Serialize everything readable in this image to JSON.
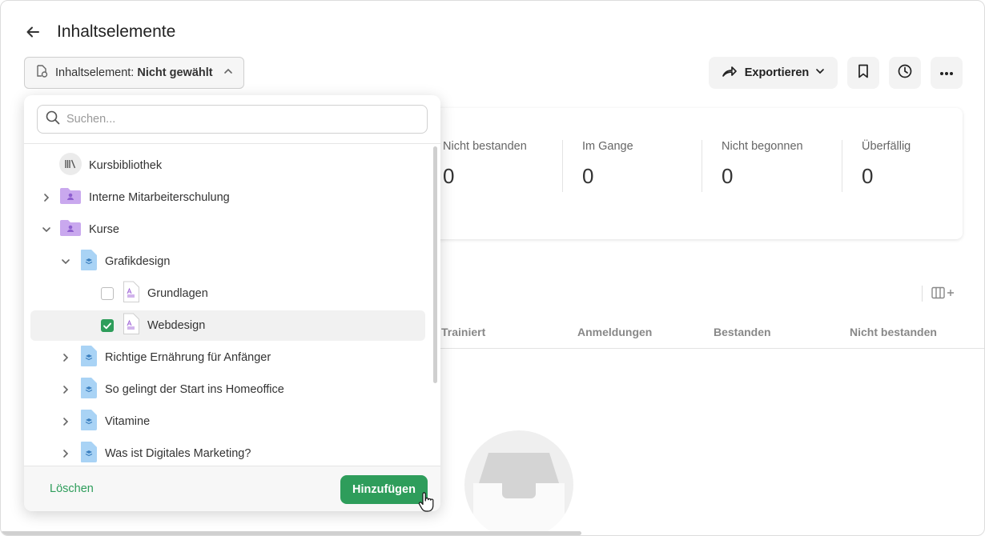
{
  "header": {
    "title": "Inhaltselemente"
  },
  "selector": {
    "label": "Inhaltselement:",
    "value": "Nicht gewählt"
  },
  "toolbar": {
    "export_label": "Exportieren"
  },
  "stats": [
    {
      "label": "Nicht bestanden",
      "value": "0"
    },
    {
      "label": "Im Gange",
      "value": "0"
    },
    {
      "label": "Nicht begonnen",
      "value": "0"
    },
    {
      "label": "Überfällig",
      "value": "0"
    }
  ],
  "table": {
    "columns": [
      "Trainiert",
      "Anmeldungen",
      "Bestanden",
      "Nicht bestanden"
    ]
  },
  "dropdown": {
    "search_placeholder": "Suchen...",
    "items": [
      {
        "label": "Kursbibliothek",
        "icon": "library-icon"
      },
      {
        "label": "Interne Mitarbeiterschulung",
        "icon": "folder-icon",
        "expanded": false
      },
      {
        "label": "Kurse",
        "icon": "folder-icon",
        "expanded": true
      },
      {
        "label": "Grafikdesign",
        "icon": "course-icon",
        "expanded": true
      },
      {
        "label": "Grundlagen",
        "icon": "document-icon",
        "checked": false
      },
      {
        "label": "Webdesign",
        "icon": "document-icon",
        "checked": true
      },
      {
        "label": "Richtige Ernährung für Anfänger",
        "icon": "course-icon",
        "expanded": false
      },
      {
        "label": "So gelingt der Start ins Homeoffice",
        "icon": "course-icon",
        "expanded": false
      },
      {
        "label": "Vitamine",
        "icon": "course-icon",
        "expanded": false
      },
      {
        "label": "Was ist Digitales Marketing?",
        "icon": "course-icon",
        "expanded": false
      }
    ],
    "clear_label": "Löschen",
    "add_label": "Hinzufügen"
  },
  "colors": {
    "accent": "#2e9d5b",
    "folder": "#c9a8ee",
    "course": "#a9d3f5"
  }
}
